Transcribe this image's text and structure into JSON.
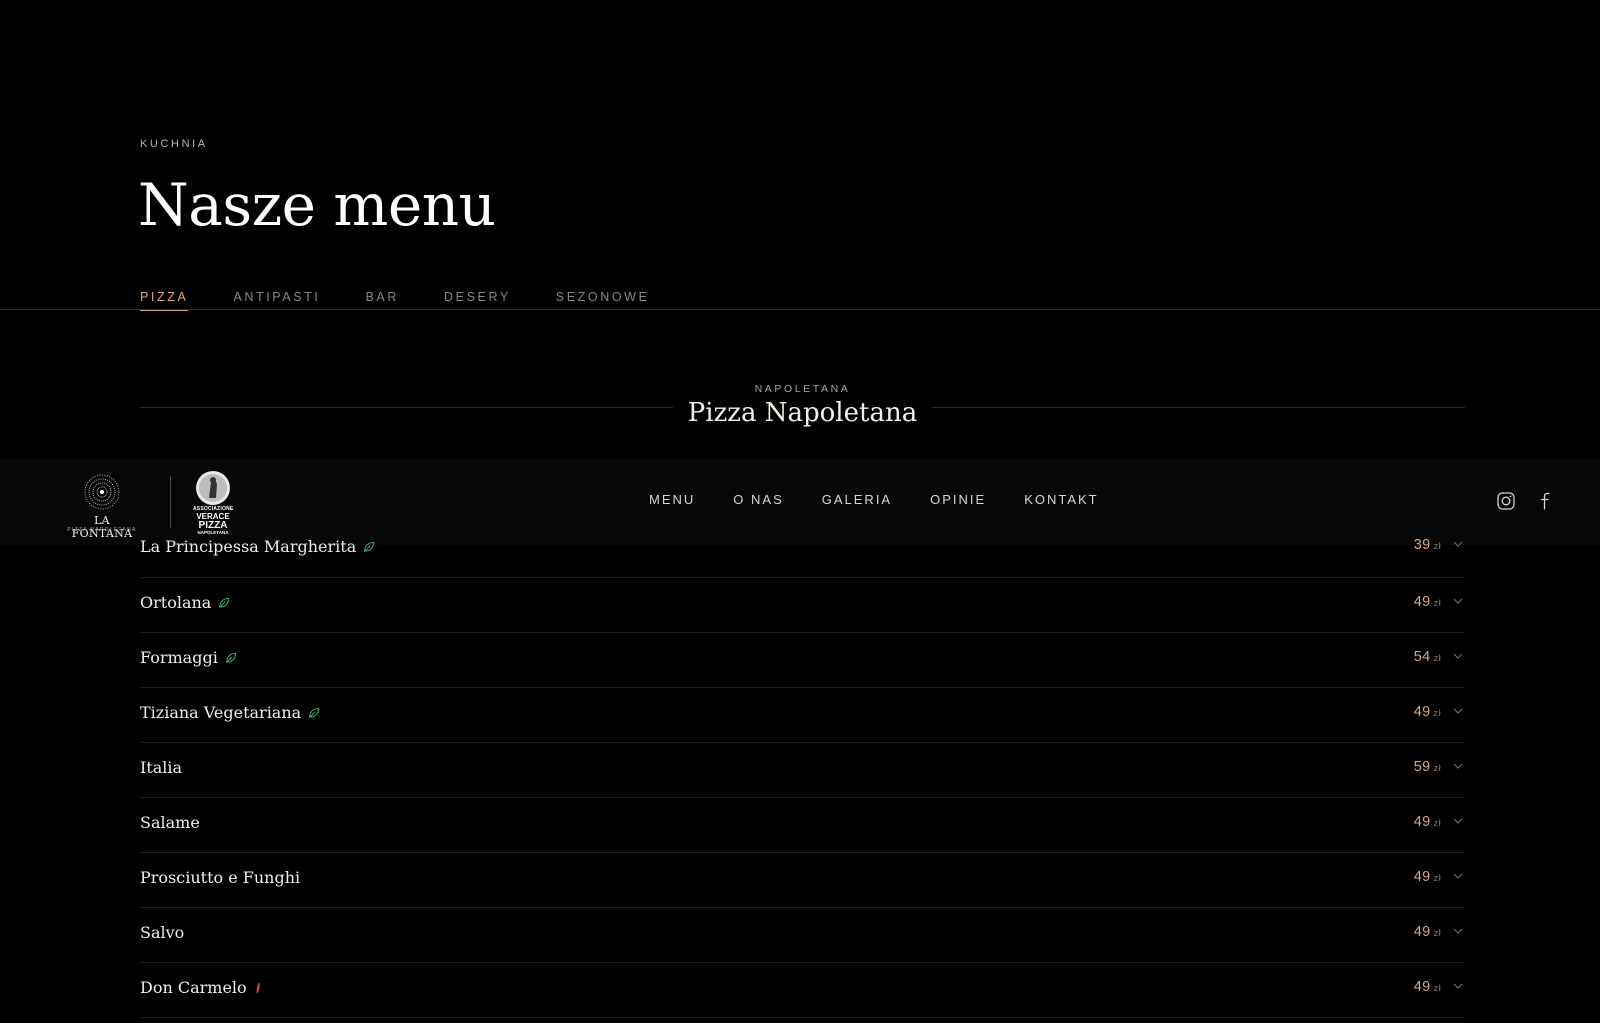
{
  "header": {
    "eyebrow": "KUCHNIA",
    "title": "Nasze menu"
  },
  "tabs": [
    {
      "label": "PIZZA",
      "active": true
    },
    {
      "label": "ANTIPASTI",
      "active": false
    },
    {
      "label": "BAR",
      "active": false
    },
    {
      "label": "DESERY",
      "active": false
    },
    {
      "label": "SEZONOWE",
      "active": false
    }
  ],
  "section": {
    "eyebrow": "NAPOLETANA",
    "title": "Pizza Napoletana"
  },
  "navbar": {
    "logo_name": "LA FONTANA",
    "logo_sub": "PIZZA NAPOLETANA",
    "avpn_line1": "ASSOCIAZIONE",
    "avpn_line2": "VERACE",
    "avpn_line3": "PIZZA",
    "avpn_line4": "NAPOLETANA",
    "links": [
      "MENU",
      "O NAS",
      "GALERIA",
      "OPINIE",
      "KONTAKT"
    ],
    "social_icons": [
      "instagram-icon",
      "facebook-icon"
    ]
  },
  "menu_items": [
    {
      "name": "La Principessa Margherita",
      "price": "39",
      "currency": "zł",
      "mark": "leaf-icon"
    },
    {
      "name": "Ortolana",
      "price": "49",
      "currency": "zł",
      "mark": "leaf-icon"
    },
    {
      "name": "Formaggi",
      "price": "54",
      "currency": "zł",
      "mark": "leaf-icon"
    },
    {
      "name": "Tiziana Vegetariana",
      "price": "49",
      "currency": "zł",
      "mark": "leaf-icon"
    },
    {
      "name": "Italia",
      "price": "59",
      "currency": "zł",
      "mark": ""
    },
    {
      "name": "Salame",
      "price": "49",
      "currency": "zł",
      "mark": ""
    },
    {
      "name": "Prosciutto e Funghi",
      "price": "49",
      "currency": "zł",
      "mark": ""
    },
    {
      "name": "Salvo",
      "price": "49",
      "currency": "zł",
      "mark": ""
    },
    {
      "name": "Don Carmelo",
      "price": "49",
      "currency": "zł",
      "mark": "chili-icon"
    }
  ],
  "colors": {
    "accent": "#d9a67f",
    "vegetarian": "#3aa866",
    "spicy": "#c9463f",
    "background": "#000000"
  }
}
